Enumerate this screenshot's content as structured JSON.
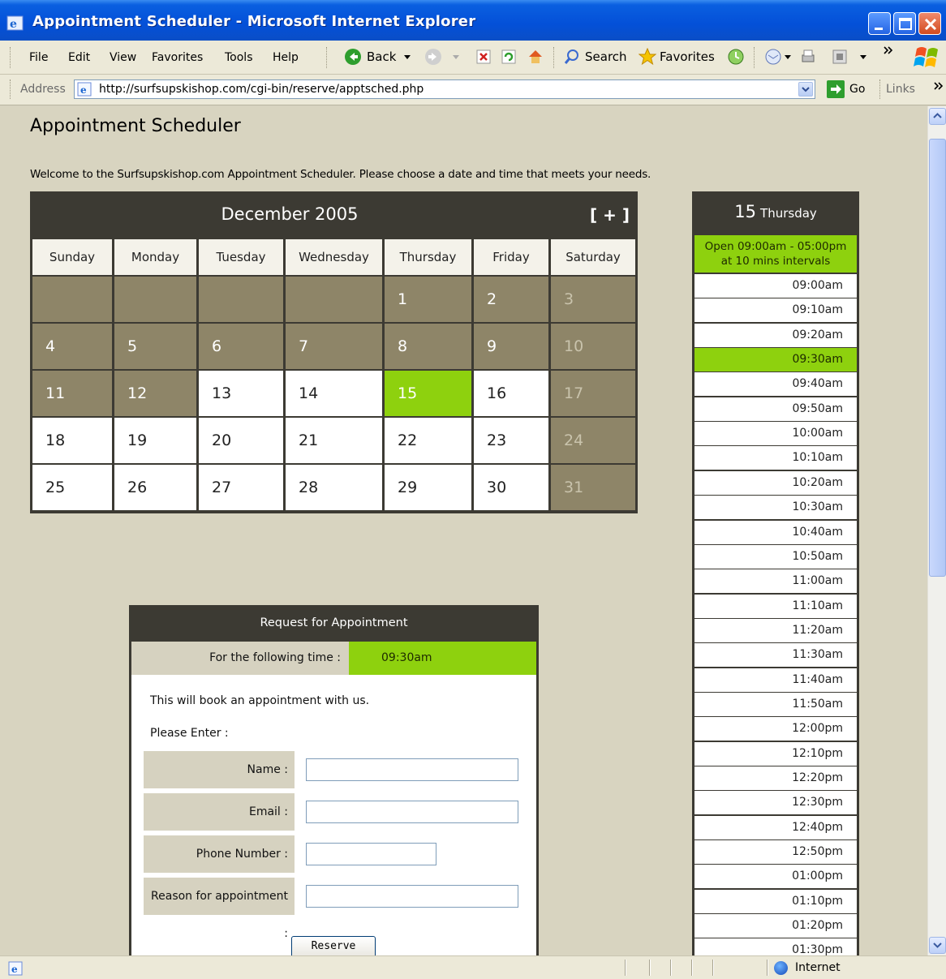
{
  "window": {
    "title": "Appointment Scheduler - Microsoft Internet Explorer"
  },
  "menu": [
    "File",
    "Edit",
    "View",
    "Favorites",
    "Tools",
    "Help"
  ],
  "toolbar": {
    "back": "Back",
    "search": "Search",
    "favorites": "Favorites"
  },
  "address": {
    "label": "Address",
    "url": "http://surfsupskishop.com/cgi-bin/reserve/apptsched.php",
    "go": "Go",
    "links": "Links"
  },
  "page": {
    "title": "Appointment Scheduler",
    "welcome": "Welcome to the Surfsupskishop.com Appointment Scheduler. Please choose a date and time that meets your needs."
  },
  "calendar": {
    "month": "December 2005",
    "toggle": "[ + ]",
    "weekdays": [
      "Sunday",
      "Monday",
      "Tuesday",
      "Wednesday",
      "Thursday",
      "Friday",
      "Saturday"
    ],
    "weeks": [
      [
        "",
        "",
        "",
        "",
        "1",
        "2",
        "3"
      ],
      [
        "4",
        "5",
        "6",
        "7",
        "8",
        "9",
        "10"
      ],
      [
        "11",
        "12",
        "13",
        "14",
        "15",
        "16",
        "17"
      ],
      [
        "18",
        "19",
        "20",
        "21",
        "22",
        "23",
        "24"
      ],
      [
        "25",
        "26",
        "27",
        "28",
        "29",
        "30",
        "31"
      ]
    ],
    "selected": "15",
    "available_from": "13"
  },
  "day_panel": {
    "day_number": "15",
    "day_name": "Thursday",
    "open_line1": "Open 09:00am - 05:00pm",
    "open_line2": "at 10 mins intervals",
    "selected_slot": "09:30am",
    "slots": [
      "09:00am",
      "09:10am",
      "09:20am",
      "09:30am",
      "09:40am",
      "09:50am",
      "10:00am",
      "10:10am",
      "10:20am",
      "10:30am",
      "10:40am",
      "10:50am",
      "11:00am",
      "11:10am",
      "11:20am",
      "11:30am",
      "11:40am",
      "11:50am",
      "12:00pm",
      "12:10pm",
      "12:20pm",
      "12:30pm",
      "12:40pm",
      "12:50pm",
      "01:00pm",
      "01:10pm",
      "01:20pm",
      "01:30pm"
    ]
  },
  "request": {
    "title": "Request for Appointment",
    "time_label": "For the following time :",
    "time_value": "09:30am",
    "intro": "This will book an appointment with us.",
    "please_enter": "Please Enter :",
    "fields": {
      "name": "Name :",
      "email": "Email :",
      "phone": "Phone Number :",
      "reason": "Reason for appointment :"
    },
    "values": {
      "name": "",
      "email": "",
      "phone": "",
      "reason": ""
    },
    "reserve": "Reserve"
  },
  "status": {
    "zone": "Internet"
  },
  "colors": {
    "accent_green": "#8ed10e",
    "panel_dark": "#3c3a33",
    "past_cell": "#8e8568",
    "page_bg": "#d8d4c0"
  }
}
